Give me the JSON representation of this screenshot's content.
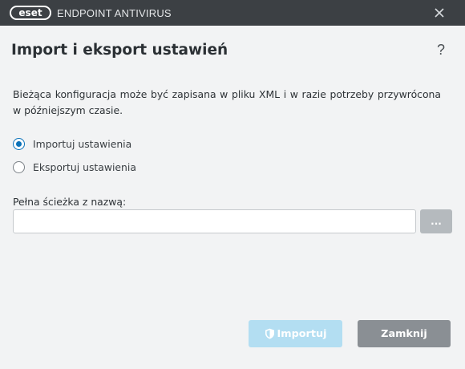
{
  "window": {
    "logo_text": "eset",
    "app_name": "ENDPOINT ANTIVIRUS"
  },
  "dialog": {
    "title": "Import i eksport ustawień",
    "help": "?",
    "description": "Bieżąca konfiguracja może być zapisana w pliku XML i w razie potrzeby przywrócona w późniejszym czasie."
  },
  "options": [
    {
      "label": "Importuj ustawienia",
      "selected": true
    },
    {
      "label": "Eksportuj ustawienia",
      "selected": false
    }
  ],
  "path": {
    "label": "Pełna ścieżka z nazwą:",
    "value": "",
    "placeholder": "",
    "browse_label": "..."
  },
  "buttons": {
    "import_label": "Importuj",
    "close_label": "Zamknij"
  },
  "colors": {
    "titlebar": "#3c4044",
    "accent": "#0b72b9",
    "import_disabled": "#b3def2",
    "close_button": "#8a8f94"
  }
}
